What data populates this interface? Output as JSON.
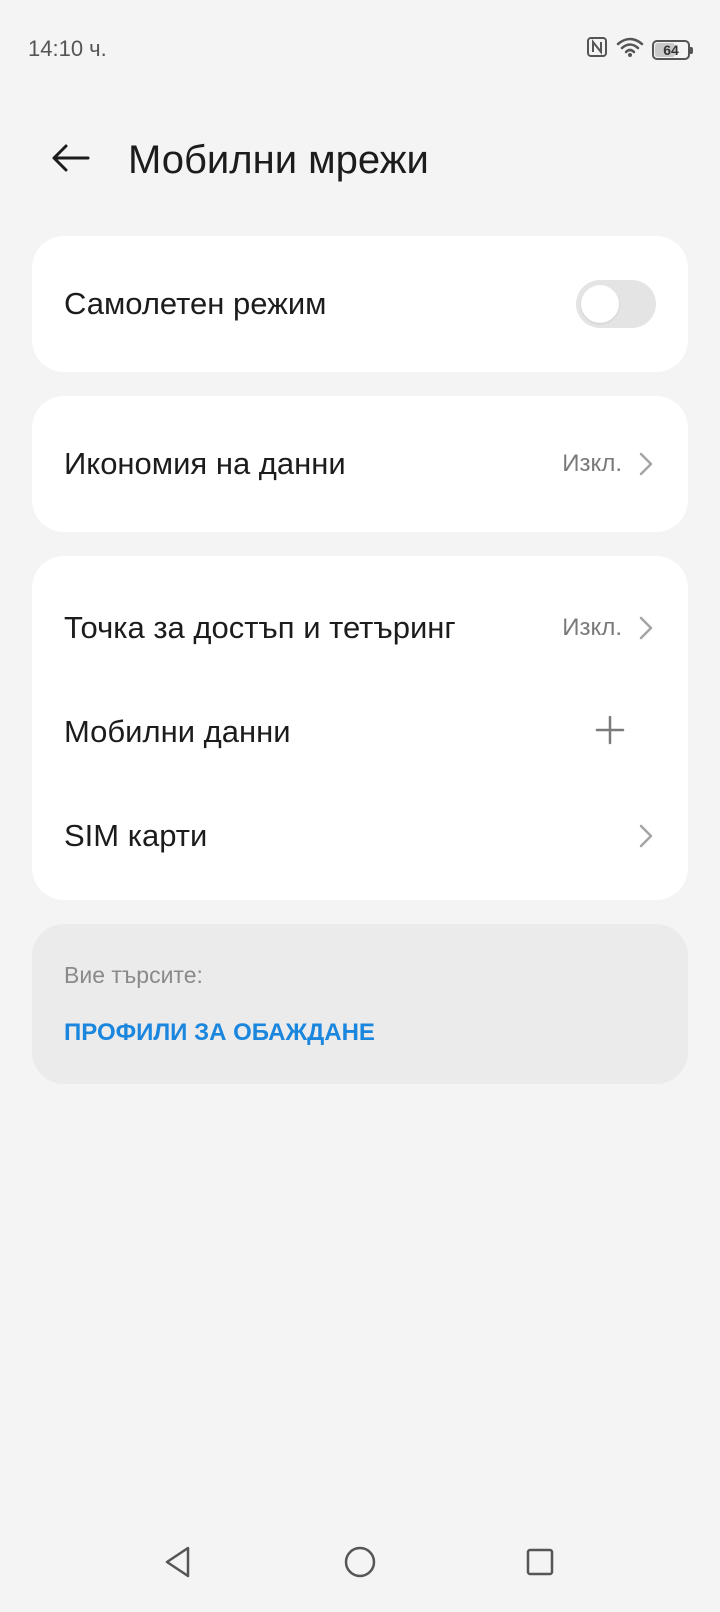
{
  "status_bar": {
    "time": "14:10 ч.",
    "battery_level": "64",
    "battery_fraction": 0.64,
    "icons": [
      "nfc-icon",
      "wifi-icon",
      "battery-icon"
    ]
  },
  "header": {
    "title": "Мобилни мрежи",
    "back_icon": "arrow-left-icon"
  },
  "airplane": {
    "label": "Самолетен режим",
    "enabled": false
  },
  "data_saver": {
    "label": "Икономия на данни",
    "value": "Изкл."
  },
  "network_items": [
    {
      "label": "Точка за достъп и тетъринг",
      "value": "Изкл.",
      "action": "chevron"
    },
    {
      "label": "Мобилни данни",
      "value": "",
      "action": "plus"
    },
    {
      "label": "SIM карти",
      "value": "",
      "action": "chevron"
    }
  ],
  "search_suggestion": {
    "label": "Вие търсите:",
    "link": "ПРОФИЛИ ЗА ОБАЖДАНЕ"
  },
  "colors": {
    "background": "#f4f4f4",
    "card": "#ffffff",
    "link": "#1a86de",
    "toggle_off": "#e4e4e4"
  },
  "nav_bar": {
    "icons": [
      "back-triangle-icon",
      "home-circle-icon",
      "recents-square-icon"
    ]
  }
}
